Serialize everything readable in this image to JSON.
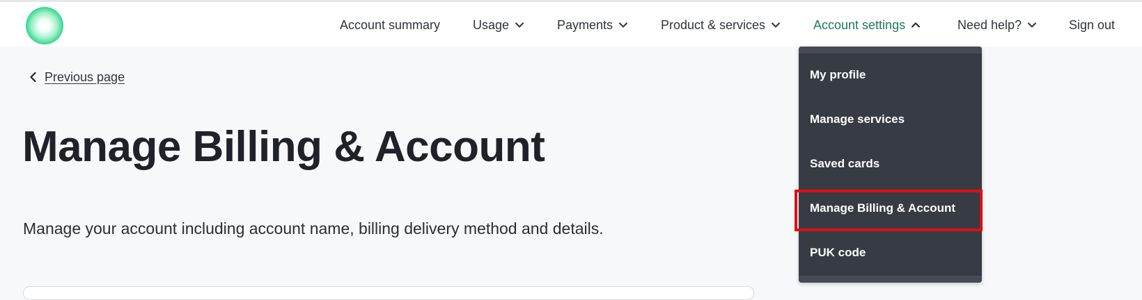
{
  "header": {
    "nav": [
      {
        "label": "Account summary",
        "chevron": null,
        "active": false
      },
      {
        "label": "Usage",
        "chevron": "down",
        "active": false
      },
      {
        "label": "Payments",
        "chevron": "down",
        "active": false
      },
      {
        "label": "Product & services",
        "chevron": "down",
        "active": false
      },
      {
        "label": "Account settings",
        "chevron": "up",
        "active": true
      },
      {
        "label": "Need help?",
        "chevron": "down",
        "active": false
      },
      {
        "label": "Sign out",
        "chevron": null,
        "active": false
      }
    ]
  },
  "dropdown": {
    "items": [
      {
        "label": "My profile"
      },
      {
        "label": "Manage services"
      },
      {
        "label": "Saved cards"
      },
      {
        "label": "Manage Billing & Account",
        "highlighted": true
      },
      {
        "label": "PUK code"
      }
    ]
  },
  "main": {
    "back_label": "Previous page",
    "title": "Manage Billing & Account",
    "description": "Manage your account including account name, billing delivery method and details."
  },
  "colors": {
    "accent": "#1e7a57",
    "dropdown_bg": "#373b44",
    "highlight": "#e10d14",
    "page_bg": "#f7f8fa"
  },
  "icons": {
    "logo": "brand-logo-green-circle",
    "back": "chevron-left-icon",
    "nav_chevron_down": "chevron-down-icon",
    "nav_chevron_up": "chevron-up-icon"
  }
}
